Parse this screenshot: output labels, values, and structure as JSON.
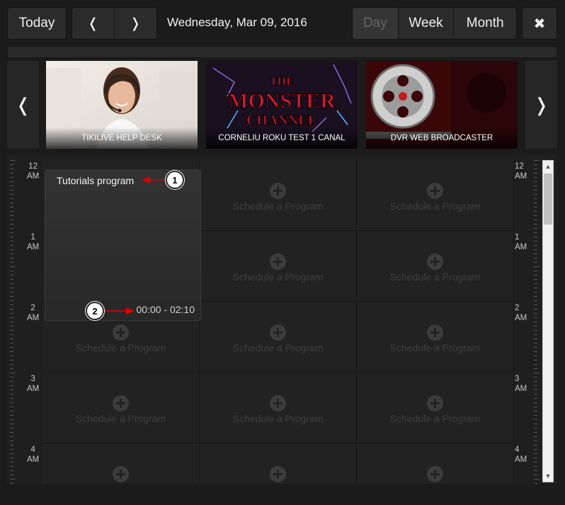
{
  "toolbar": {
    "today": "Today",
    "prev": "❬",
    "next": "❭",
    "date": "Wednesday, Mar 09, 2016",
    "views": [
      "Day",
      "Week",
      "Month"
    ],
    "active_view": "Day",
    "close": "✖"
  },
  "carousel": {
    "prev": "❬",
    "next": "❭",
    "channels": [
      {
        "name": "TIKILIVE HELP DESK"
      },
      {
        "name": "CORNELIU ROKU TEST 1 CANAL",
        "logo_top": "THE",
        "logo_main": "MONSTER",
        "logo_bottom": "CHANNEL"
      },
      {
        "name": "DVR WEB BROADCASTER"
      }
    ]
  },
  "calendar": {
    "hours": [
      {
        "num": "12",
        "ampm": "AM"
      },
      {
        "num": "1",
        "ampm": "AM"
      },
      {
        "num": "2",
        "ampm": "AM"
      },
      {
        "num": "3",
        "ampm": "AM"
      },
      {
        "num": "4",
        "ampm": "AM"
      }
    ],
    "slot_label": "Schedule a Program",
    "program": {
      "title": "Tutorials program",
      "time": "00:00 - 02:10"
    },
    "callouts": [
      "1",
      "2"
    ]
  },
  "colors": {
    "accent_arrow": "#e00000",
    "background": "#1b1b1b"
  }
}
